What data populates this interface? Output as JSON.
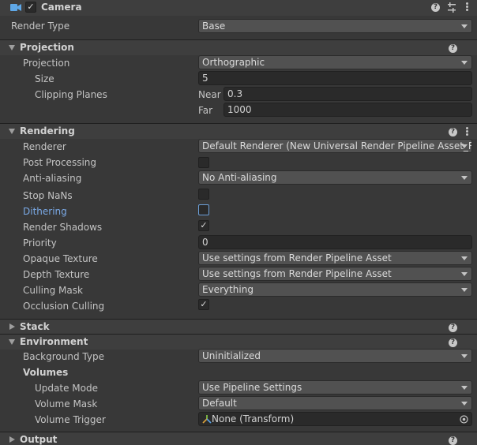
{
  "component": {
    "title": "Camera",
    "enabled_check": "✓",
    "icons": [
      "camera-icon",
      "help-icon",
      "presets-icon",
      "more-icon"
    ]
  },
  "render_type": {
    "label": "Render Type",
    "value": "Base"
  },
  "projection": {
    "header": "Projection",
    "projection_label": "Projection",
    "projection_value": "Orthographic",
    "size_label": "Size",
    "size_value": "5",
    "clipping_label": "Clipping Planes",
    "near_label": "Near",
    "near_value": "0.3",
    "far_label": "Far",
    "far_value": "1000"
  },
  "rendering": {
    "header": "Rendering",
    "renderer_label": "Renderer",
    "renderer_value": "Default Renderer (New Universal Render Pipeline Asset_Re",
    "post_processing_label": "Post Processing",
    "post_processing_checked": false,
    "anti_aliasing_label": "Anti-aliasing",
    "anti_aliasing_value": "No Anti-aliasing",
    "stop_nans_label": "Stop NaNs",
    "stop_nans_checked": false,
    "dithering_label": "Dithering",
    "dithering_checked": false,
    "render_shadows_label": "Render Shadows",
    "render_shadows_check": "✓",
    "priority_label": "Priority",
    "priority_value": "0",
    "opaque_texture_label": "Opaque Texture",
    "opaque_texture_value": "Use settings from Render Pipeline Asset",
    "depth_texture_label": "Depth Texture",
    "depth_texture_value": "Use settings from Render Pipeline Asset",
    "culling_mask_label": "Culling Mask",
    "culling_mask_value": "Everything",
    "occlusion_culling_label": "Occlusion Culling",
    "occlusion_culling_check": "✓"
  },
  "stack": {
    "header": "Stack"
  },
  "environment": {
    "header": "Environment",
    "background_type_label": "Background Type",
    "background_type_value": "Uninitialized",
    "volumes_label": "Volumes",
    "update_mode_label": "Update Mode",
    "update_mode_value": "Use Pipeline Settings",
    "volume_mask_label": "Volume Mask",
    "volume_mask_value": "Default",
    "volume_trigger_label": "Volume Trigger",
    "volume_trigger_value": "None (Transform)"
  },
  "output": {
    "header": "Output"
  },
  "colors": {
    "background": "#383838",
    "header_background": "#3e3e3e",
    "accent_label": "#7aa9e6",
    "camera_icon": "#5fa8e8"
  }
}
